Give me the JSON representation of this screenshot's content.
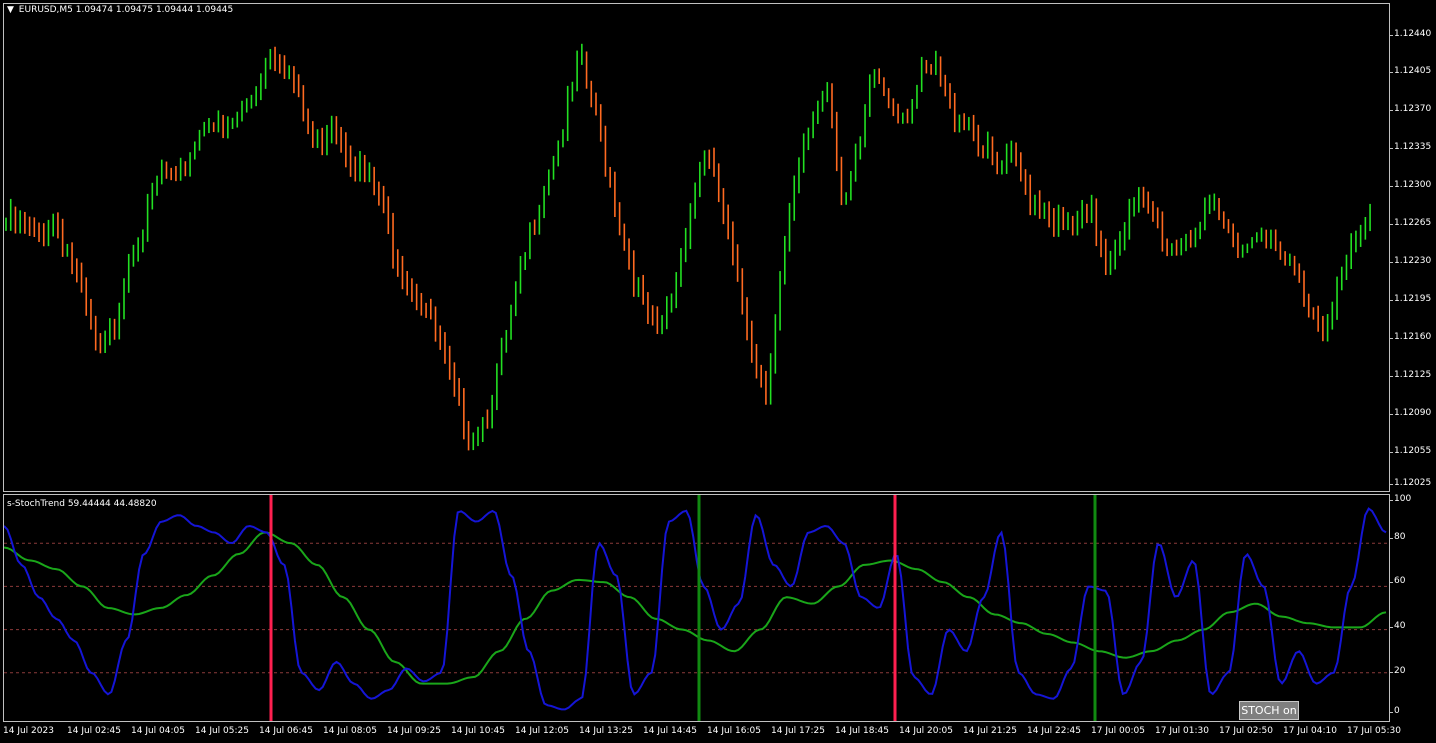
{
  "main": {
    "symbol_label": "EURUSD,M5",
    "ohlc": "1.09474 1.09475 1.09444 1.09445",
    "price_ticks": [
      "1.12440",
      "1.12405",
      "1.12370",
      "1.12335",
      "1.12300",
      "1.12265",
      "1.12230",
      "1.12195",
      "1.12160",
      "1.12125",
      "1.12090",
      "1.12055",
      "1.12025"
    ],
    "colors": {
      "up": "#22e022",
      "down": "#ff6a20",
      "background": "#000000"
    }
  },
  "indicator": {
    "label": "s-StochTrend 59.44444 44.48820",
    "ticks": [
      "100",
      "80",
      "60",
      "40",
      "20",
      "0"
    ],
    "levels": [
      80,
      60,
      40,
      20
    ],
    "colors": {
      "fast": "#1515d6",
      "slow": "#1aa61a",
      "sell_signal": "#ff2050",
      "buy_signal": "#118a11",
      "level": "#8b3a3a"
    }
  },
  "time_labels": [
    "14 Jul 2023",
    "14 Jul 02:45",
    "14 Jul 04:05",
    "14 Jul 05:25",
    "14 Jul 06:45",
    "14 Jul 08:05",
    "14 Jul 09:25",
    "14 Jul 10:45",
    "14 Jul 12:05",
    "14 Jul 13:25",
    "14 Jul 14:45",
    "14 Jul 16:05",
    "14 Jul 17:25",
    "14 Jul 18:45",
    "14 Jul 20:05",
    "14 Jul 21:25",
    "14 Jul 22:45",
    "17 Jul 00:05",
    "17 Jul 01:30",
    "17 Jul 02:50",
    "17 Jul 04:10",
    "17 Jul 05:30"
  ],
  "stoch_button": "STOCH on",
  "chart_data": {
    "type": "bar",
    "series_price_close": [
      1.12265,
      1.1226,
      1.1225,
      1.1227,
      1.1224,
      1.1219,
      1.1214,
      1.1217,
      1.1224,
      1.1226,
      1.1231,
      1.1229,
      1.1233,
      1.1236,
      1.1234,
      1.1236,
      1.1238,
      1.1242,
      1.1241,
      1.1237,
      1.1233,
      1.1236,
      1.1233,
      1.1231,
      1.1229,
      1.1224,
      1.1221,
      1.1219,
      1.1215,
      1.121,
      1.1207,
      1.1209,
      1.1214,
      1.122,
      1.1226,
      1.1231,
      1.1235,
      1.1241,
      1.1236,
      1.123,
      1.1224,
      1.1219,
      1.1216,
      1.122,
      1.1227,
      1.1233,
      1.1229,
      1.1222,
      1.1216,
      1.1211,
      1.1222,
      1.123,
      1.1236,
      1.1239,
      1.1228,
      1.1232,
      1.124,
      1.1237,
      1.1236,
      1.1239,
      1.124,
      1.1236,
      1.1236,
      1.1233,
      1.1231,
      1.1232,
      1.1229,
      1.1228,
      1.1226,
      1.1226,
      1.1227,
      1.1223,
      1.1226,
      1.1228,
      1.1227,
      1.1224,
      1.1225,
      1.1226,
      1.1227,
      1.1225,
      1.1224,
      1.1226,
      1.1223,
      1.1222,
      1.1219,
      1.1217,
      1.1221,
      1.1224,
      1.1227
    ],
    "stoch_fast": [
      88,
      70,
      55,
      45,
      35,
      20,
      10,
      35,
      75,
      90,
      93,
      88,
      85,
      80,
      88,
      85,
      70,
      20,
      12,
      25,
      15,
      8,
      12,
      22,
      16,
      20,
      95,
      90,
      95,
      65,
      30,
      5,
      3,
      8,
      80,
      65,
      10,
      20,
      90,
      95,
      60,
      40,
      52,
      93,
      70,
      60,
      85,
      88,
      80,
      55,
      50,
      75,
      18,
      10,
      40,
      30,
      55,
      85,
      20,
      10,
      8,
      22,
      60,
      58,
      10,
      25,
      80,
      55,
      72,
      10,
      20,
      75,
      60,
      15,
      30,
      15,
      20,
      60,
      96,
      85
    ],
    "stoch_slow": [
      78,
      72,
      68,
      60,
      50,
      47,
      50,
      56,
      65,
      75,
      85,
      80,
      70,
      55,
      40,
      25,
      15,
      15,
      18,
      30,
      45,
      58,
      63,
      62,
      55,
      45,
      40,
      35,
      30,
      40,
      55,
      52,
      60,
      70,
      72,
      68,
      62,
      55,
      47,
      43,
      38,
      34,
      30,
      27,
      30,
      35,
      40,
      48,
      52,
      46,
      43,
      41,
      41,
      48
    ]
  }
}
